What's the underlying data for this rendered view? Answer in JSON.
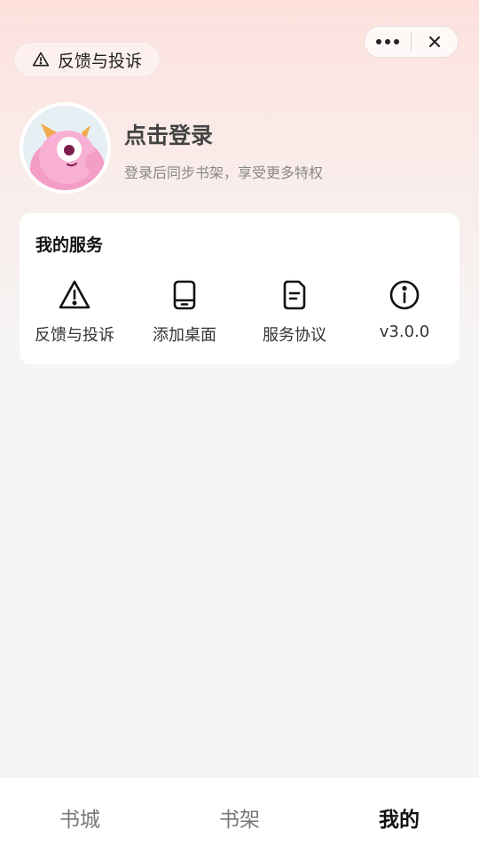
{
  "top_bar": {
    "feedback_label": "反馈与投诉"
  },
  "profile": {
    "login_title": "点击登录",
    "login_subtitle": "登录后同步书架，享受更多特权"
  },
  "services": {
    "title": "我的服务",
    "items": [
      {
        "label": "反馈与投诉",
        "icon": "warning-icon"
      },
      {
        "label": "添加桌面",
        "icon": "phone-icon"
      },
      {
        "label": "服务协议",
        "icon": "document-icon"
      },
      {
        "label": "v3.0.0",
        "icon": "info-icon"
      }
    ]
  },
  "tabbar": {
    "tabs": [
      {
        "label": "书城",
        "active": false
      },
      {
        "label": "书架",
        "active": false
      },
      {
        "label": "我的",
        "active": true
      }
    ]
  },
  "colors": {
    "header_gradient_top": "#fde0dc",
    "page_background": "#f5f5f5",
    "text_primary": "#111111",
    "text_muted": "#888888"
  }
}
